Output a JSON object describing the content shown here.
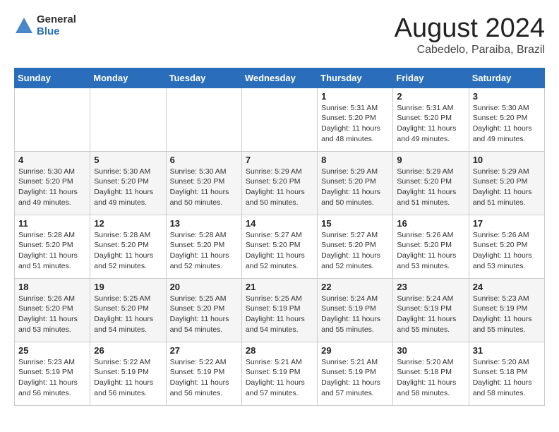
{
  "header": {
    "logo_general": "General",
    "logo_blue": "Blue",
    "month_title": "August 2024",
    "location": "Cabedelo, Paraiba, Brazil"
  },
  "weekdays": [
    "Sunday",
    "Monday",
    "Tuesday",
    "Wednesday",
    "Thursday",
    "Friday",
    "Saturday"
  ],
  "weeks": [
    [
      {
        "day": "",
        "info": ""
      },
      {
        "day": "",
        "info": ""
      },
      {
        "day": "",
        "info": ""
      },
      {
        "day": "",
        "info": ""
      },
      {
        "day": "1",
        "info": "Sunrise: 5:31 AM\nSunset: 5:20 PM\nDaylight: 11 hours\nand 48 minutes."
      },
      {
        "day": "2",
        "info": "Sunrise: 5:31 AM\nSunset: 5:20 PM\nDaylight: 11 hours\nand 49 minutes."
      },
      {
        "day": "3",
        "info": "Sunrise: 5:30 AM\nSunset: 5:20 PM\nDaylight: 11 hours\nand 49 minutes."
      }
    ],
    [
      {
        "day": "4",
        "info": "Sunrise: 5:30 AM\nSunset: 5:20 PM\nDaylight: 11 hours\nand 49 minutes."
      },
      {
        "day": "5",
        "info": "Sunrise: 5:30 AM\nSunset: 5:20 PM\nDaylight: 11 hours\nand 49 minutes."
      },
      {
        "day": "6",
        "info": "Sunrise: 5:30 AM\nSunset: 5:20 PM\nDaylight: 11 hours\nand 50 minutes."
      },
      {
        "day": "7",
        "info": "Sunrise: 5:29 AM\nSunset: 5:20 PM\nDaylight: 11 hours\nand 50 minutes."
      },
      {
        "day": "8",
        "info": "Sunrise: 5:29 AM\nSunset: 5:20 PM\nDaylight: 11 hours\nand 50 minutes."
      },
      {
        "day": "9",
        "info": "Sunrise: 5:29 AM\nSunset: 5:20 PM\nDaylight: 11 hours\nand 51 minutes."
      },
      {
        "day": "10",
        "info": "Sunrise: 5:29 AM\nSunset: 5:20 PM\nDaylight: 11 hours\nand 51 minutes."
      }
    ],
    [
      {
        "day": "11",
        "info": "Sunrise: 5:28 AM\nSunset: 5:20 PM\nDaylight: 11 hours\nand 51 minutes."
      },
      {
        "day": "12",
        "info": "Sunrise: 5:28 AM\nSunset: 5:20 PM\nDaylight: 11 hours\nand 52 minutes."
      },
      {
        "day": "13",
        "info": "Sunrise: 5:28 AM\nSunset: 5:20 PM\nDaylight: 11 hours\nand 52 minutes."
      },
      {
        "day": "14",
        "info": "Sunrise: 5:27 AM\nSunset: 5:20 PM\nDaylight: 11 hours\nand 52 minutes."
      },
      {
        "day": "15",
        "info": "Sunrise: 5:27 AM\nSunset: 5:20 PM\nDaylight: 11 hours\nand 52 minutes."
      },
      {
        "day": "16",
        "info": "Sunrise: 5:26 AM\nSunset: 5:20 PM\nDaylight: 11 hours\nand 53 minutes."
      },
      {
        "day": "17",
        "info": "Sunrise: 5:26 AM\nSunset: 5:20 PM\nDaylight: 11 hours\nand 53 minutes."
      }
    ],
    [
      {
        "day": "18",
        "info": "Sunrise: 5:26 AM\nSunset: 5:20 PM\nDaylight: 11 hours\nand 53 minutes."
      },
      {
        "day": "19",
        "info": "Sunrise: 5:25 AM\nSunset: 5:20 PM\nDaylight: 11 hours\nand 54 minutes."
      },
      {
        "day": "20",
        "info": "Sunrise: 5:25 AM\nSunset: 5:20 PM\nDaylight: 11 hours\nand 54 minutes."
      },
      {
        "day": "21",
        "info": "Sunrise: 5:25 AM\nSunset: 5:19 PM\nDaylight: 11 hours\nand 54 minutes."
      },
      {
        "day": "22",
        "info": "Sunrise: 5:24 AM\nSunset: 5:19 PM\nDaylight: 11 hours\nand 55 minutes."
      },
      {
        "day": "23",
        "info": "Sunrise: 5:24 AM\nSunset: 5:19 PM\nDaylight: 11 hours\nand 55 minutes."
      },
      {
        "day": "24",
        "info": "Sunrise: 5:23 AM\nSunset: 5:19 PM\nDaylight: 11 hours\nand 55 minutes."
      }
    ],
    [
      {
        "day": "25",
        "info": "Sunrise: 5:23 AM\nSunset: 5:19 PM\nDaylight: 11 hours\nand 56 minutes."
      },
      {
        "day": "26",
        "info": "Sunrise: 5:22 AM\nSunset: 5:19 PM\nDaylight: 11 hours\nand 56 minutes."
      },
      {
        "day": "27",
        "info": "Sunrise: 5:22 AM\nSunset: 5:19 PM\nDaylight: 11 hours\nand 56 minutes."
      },
      {
        "day": "28",
        "info": "Sunrise: 5:21 AM\nSunset: 5:19 PM\nDaylight: 11 hours\nand 57 minutes."
      },
      {
        "day": "29",
        "info": "Sunrise: 5:21 AM\nSunset: 5:19 PM\nDaylight: 11 hours\nand 57 minutes."
      },
      {
        "day": "30",
        "info": "Sunrise: 5:20 AM\nSunset: 5:18 PM\nDaylight: 11 hours\nand 58 minutes."
      },
      {
        "day": "31",
        "info": "Sunrise: 5:20 AM\nSunset: 5:18 PM\nDaylight: 11 hours\nand 58 minutes."
      }
    ]
  ]
}
